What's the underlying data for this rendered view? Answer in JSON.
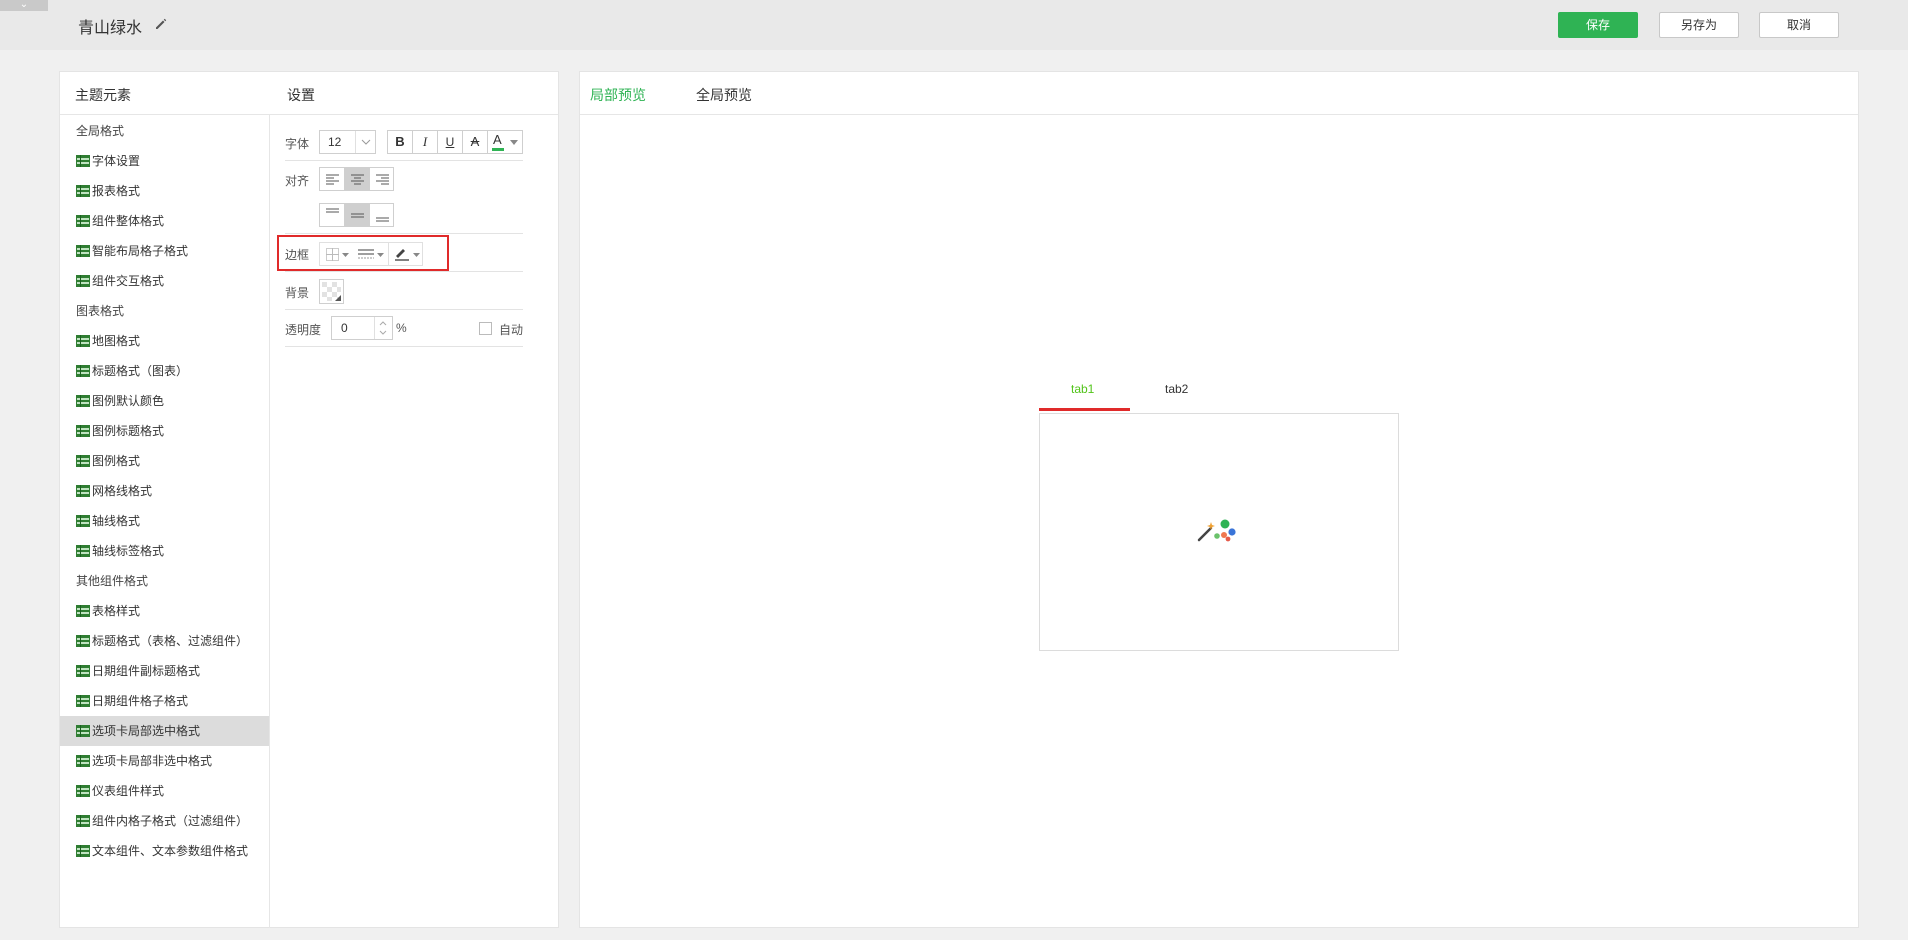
{
  "header": {
    "collapse_glyph": "⌄",
    "theme_title": "青山绿水",
    "save_label": "保存",
    "save_as_label": "另存为",
    "cancel_label": "取消",
    "accent_color": "#2fb354"
  },
  "left_panel": {
    "elements_header": "主题元素",
    "settings_header": "设置"
  },
  "tree": {
    "g1": "全局格式",
    "i1": "字体设置",
    "i2": "报表格式",
    "i3": "组件整体格式",
    "i4": "智能布局格子格式",
    "i5": "组件交互格式",
    "g2": "图表格式",
    "i6": "地图格式",
    "i7": "标题格式（图表）",
    "i8": "图例默认颜色",
    "i9": "图例标题格式",
    "i10": "图例格式",
    "i11": "网格线格式",
    "i12": "轴线格式",
    "i13": "轴线标签格式",
    "g3": "其他组件格式",
    "i14": "表格样式",
    "i15": "标题格式（表格、过滤组件）",
    "i16": "日期组件副标题格式",
    "i17": "日期组件格子格式",
    "i18": "选项卡局部选中格式",
    "i19": "选项卡局部非选中格式",
    "i20": "仪表组件样式",
    "i21": "组件内格子格式（过滤组件）",
    "i22": "文本组件、文本参数组件格式"
  },
  "settings": {
    "font_label": "字体",
    "font_size": "12",
    "bold": "B",
    "italic": "I",
    "underline": "U",
    "strike": "A",
    "font_color": "A",
    "align_label": "对齐",
    "border_label": "边框",
    "background_label": "背景",
    "opacity_label": "透明度",
    "opacity_value": "0",
    "percent": "%",
    "auto_label": "自动"
  },
  "preview": {
    "local_tab": "局部预览",
    "global_tab": "全局预览",
    "tab1": "tab1",
    "tab2": "tab2"
  }
}
